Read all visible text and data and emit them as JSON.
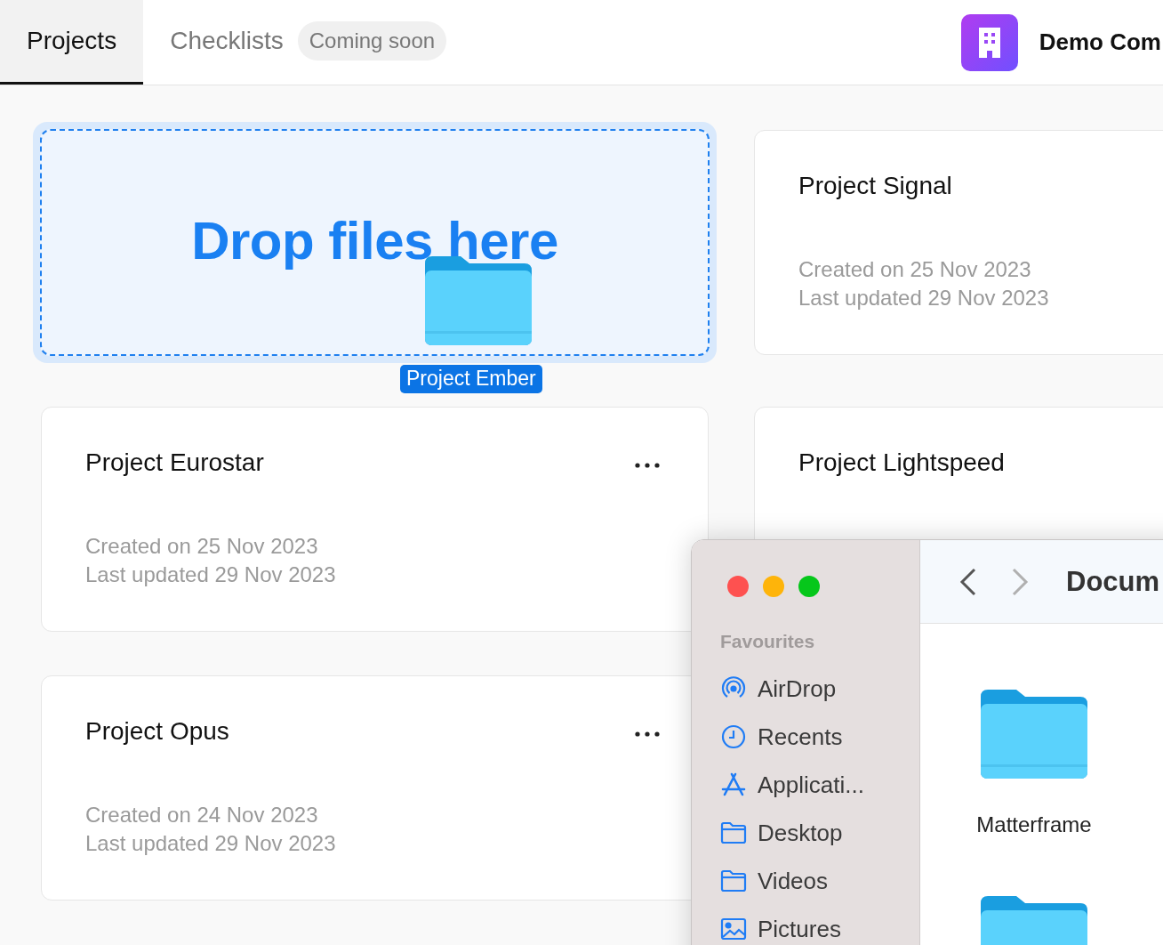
{
  "tabs": [
    {
      "label": "Projects",
      "selected": true
    },
    {
      "label": "Checklists",
      "selected": false,
      "badge": "Coming soon"
    }
  ],
  "company": {
    "name": "Demo Com"
  },
  "drop_zone": {
    "title": "Drop files here",
    "dragged_item": "Project Ember"
  },
  "projects": [
    {
      "name": "Project Signal",
      "created": "Created on 25 Nov 2023",
      "updated": "Last updated 29 Nov 2023",
      "menu": false
    },
    {
      "name": "Project Eurostar",
      "created": "Created on 25 Nov 2023",
      "updated": "Last updated 29 Nov 2023",
      "menu": true
    },
    {
      "name": "Project Lightspeed",
      "menu": false
    },
    {
      "name": "Project Opus",
      "created": "Created on 24 Nov 2023",
      "updated": "Last updated 29 Nov 2023",
      "menu": true
    }
  ],
  "finder": {
    "path_title": "Docum",
    "sidebar_heading": "Favourites",
    "sidebar_items": [
      {
        "label": "AirDrop",
        "kind": "airdrop"
      },
      {
        "label": "Recents",
        "kind": "clock"
      },
      {
        "label": "Applicati...",
        "kind": "apps"
      },
      {
        "label": "Desktop",
        "kind": "folder"
      },
      {
        "label": "Videos",
        "kind": "folder"
      },
      {
        "label": "Pictures",
        "kind": "photo"
      }
    ],
    "files": [
      {
        "kind": "folder",
        "name": "Matterframe"
      },
      {
        "kind": "folder"
      }
    ]
  }
}
